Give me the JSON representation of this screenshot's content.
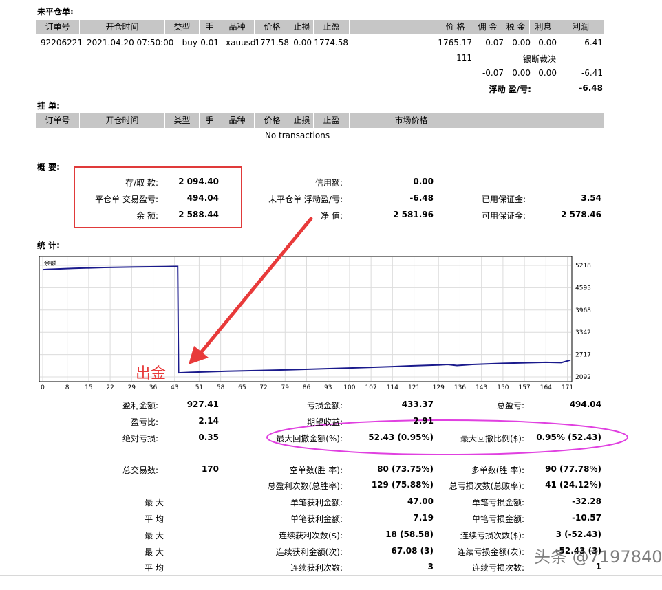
{
  "open_orders": {
    "title": "未平仓单:",
    "columns": [
      "订单号",
      "开仓时间",
      "类型",
      "手",
      "品种",
      "价格",
      "止损",
      "止盈",
      "价 格",
      "佣 金",
      "税 金",
      "利息",
      "利润"
    ],
    "row": {
      "ticket": "92206221",
      "time": "2021.04.20 07:50:00",
      "type": "buy",
      "lots": "0.01",
      "symbol": "xauusd",
      "price": "1771.58",
      "sl": "0.00",
      "tp": "1774.58",
      "cur_price": "1765.17",
      "commission": "-0.07",
      "tax": "0.00",
      "swap": "0.00",
      "profit": "-6.41"
    },
    "comment_left": "111",
    "comment_right": "银断裁决",
    "subtotal": {
      "commission": "-0.07",
      "tax": "0.00",
      "swap": "0.00",
      "profit": "-6.41"
    },
    "floating_label": "浮动 盈/亏:",
    "floating_value": "-6.48"
  },
  "pending": {
    "title": "挂 单:",
    "columns": [
      "订单号",
      "开仓时间",
      "类型",
      "手",
      "品种",
      "价格",
      "止损",
      "止盈",
      "市场价格"
    ],
    "empty": "No transactions"
  },
  "summary": {
    "title": "概 要:",
    "deposit_label": "存/取 款:",
    "deposit": "2 094.40",
    "closed_pl_label": "平仓单 交易盈亏:",
    "closed_pl": "494.04",
    "balance_label": "余 额:",
    "balance": "2 588.44",
    "credit_label": "信用额:",
    "credit": "0.00",
    "float_pl_label": "未平仓单 浮动盈/亏:",
    "float_pl": "-6.48",
    "equity_label": "净 值:",
    "equity": "2 581.96",
    "margin_label": "已用保证金:",
    "margin": "3.54",
    "free_margin_label": "可用保证金:",
    "free_margin": "2 578.46"
  },
  "stats_title": "统 计:",
  "chart_data": {
    "type": "line",
    "title": "余额",
    "y_ticks": [
      "5218",
      "4593",
      "3968",
      "3342",
      "2717",
      "2092"
    ],
    "ylim": [
      2092,
      5218
    ],
    "x_ticks": [
      "0",
      "8",
      "15",
      "22",
      "29",
      "36",
      "43",
      "51",
      "58",
      "65",
      "72",
      "79",
      "86",
      "93",
      "100",
      "107",
      "114",
      "121",
      "129",
      "136",
      "143",
      "150",
      "157",
      "164",
      "171"
    ],
    "xlim": [
      0,
      172
    ],
    "series": [
      {
        "x": [
          0,
          2,
          10,
          20,
          30,
          40,
          43,
          44,
          44.3,
          48,
          60,
          80,
          100,
          114,
          120,
          129,
          132,
          135,
          140,
          150,
          164,
          169,
          172
        ],
        "y": [
          5100,
          5110,
          5135,
          5160,
          5175,
          5185,
          5190,
          5190,
          2205,
          2220,
          2250,
          2290,
          2340,
          2380,
          2400,
          2425,
          2440,
          2410,
          2440,
          2470,
          2500,
          2490,
          2560
        ]
      }
    ],
    "line_color": "#1a1a8c"
  },
  "annotation": {
    "withdraw_label": "出金",
    "arrow_color": "#e83a3a",
    "box_color": "#e03a3a",
    "ellipse_color": "#e040e0"
  },
  "stats": {
    "gross_profit_label": "盈利金额:",
    "gross_profit": "927.41",
    "gross_loss_label": "亏损金额:",
    "gross_loss": "433.37",
    "total_net_label": "总盈亏:",
    "total_net": "494.04",
    "profit_factor_label": "盈亏比:",
    "profit_factor": "2.14",
    "expected_label": "期望收益:",
    "expected": "2.91",
    "abs_dd_label": "绝对亏损:",
    "abs_dd": "0.35",
    "max_dd_label": "最大回撤金额(%):",
    "max_dd": "52.43 (0.95%)",
    "max_dd_rel_label": "最大回撤比例($):",
    "max_dd_rel": "0.95% (52.43)",
    "total_trades_label": "总交易数:",
    "total_trades": "170",
    "short_label": "空单数(胜 率):",
    "short": "80 (73.75%)",
    "long_label": "多单数(胜 率):",
    "long": "90 (77.78%)",
    "win_count_label": "总盈利次数(总胜率):",
    "win_count": "129 (75.88%)",
    "loss_count_label": "总亏损次数(总败率):",
    "loss_count": "41 (24.12%)",
    "max1": "最 大",
    "largest_win_label": "单笔获利金额:",
    "largest_win": "47.00",
    "largest_loss_label": "单笔亏损金额:",
    "largest_loss": "-32.28",
    "avg1": "平 均",
    "avg_win_label": "单笔获利金额:",
    "avg_win": "7.19",
    "avg_loss_label": "单笔亏损金额:",
    "avg_loss": "-10.57",
    "max2": "最 大",
    "cons_wins_label": "连续获利次数($):",
    "cons_wins": "18 (58.58)",
    "cons_losses_label": "连续亏损次数($):",
    "cons_losses": "3 (-52.43)",
    "max3": "最 大",
    "cons_profit_label": "连续获利金额(次):",
    "cons_profit": "67.08 (3)",
    "cons_loss_label": "连续亏损金额(次):",
    "cons_loss": "-52.43 (3)",
    "avg2": "平 均",
    "avg_cons_wins_label": "连续获利次数:",
    "avg_cons_wins": "3",
    "avg_cons_losses_label": "连续亏损次数:",
    "avg_cons_losses": "1"
  },
  "watermark": "头条 @7197840"
}
